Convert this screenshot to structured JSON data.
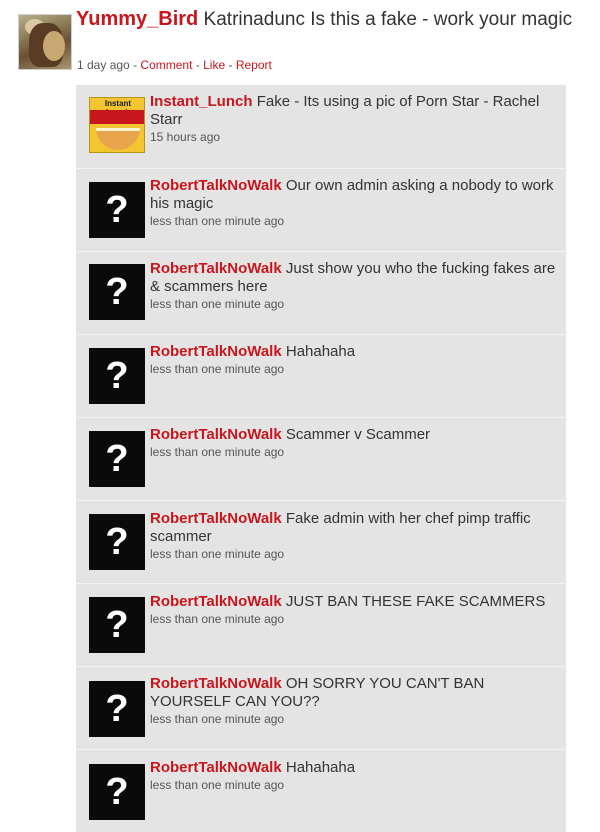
{
  "post": {
    "author": "Yummy_Bird",
    "text": "Katrinadunc Is this a fake - work your magic",
    "time": "1 day ago",
    "actions": {
      "separator": "-",
      "comment": "Comment",
      "like": "Like",
      "report": "Report"
    }
  },
  "replies": [
    {
      "author": "Instant_Lunch",
      "text": "Fake - Its using a pic of Porn Star - Rachel Starr",
      "time": "15 hours ago",
      "avatar_icon": "instant-lunch-noodle-icon",
      "avatar_text": "Instant Lunch"
    },
    {
      "author": "RobertTalkNoWalk",
      "text": "Our own admin asking a nobody to work his magic",
      "time": "less than one minute ago",
      "avatar_icon": "question-mark-icon"
    },
    {
      "author": "RobertTalkNoWalk",
      "text": "Just show you who the fucking fakes are & scammers here",
      "time": "less than one minute ago",
      "avatar_icon": "question-mark-icon"
    },
    {
      "author": "RobertTalkNoWalk",
      "text": "Hahahaha",
      "time": "less than one minute ago",
      "avatar_icon": "question-mark-icon"
    },
    {
      "author": "RobertTalkNoWalk",
      "text": "Scammer v Scammer",
      "time": "less than one minute ago",
      "avatar_icon": "question-mark-icon"
    },
    {
      "author": "RobertTalkNoWalk",
      "text": "Fake admin with her chef pimp traffic scammer",
      "time": "less than one minute ago",
      "avatar_icon": "question-mark-icon"
    },
    {
      "author": "RobertTalkNoWalk",
      "text": "JUST BAN THESE FAKE SCAMMERS",
      "time": "less than one minute ago",
      "avatar_icon": "question-mark-icon"
    },
    {
      "author": "RobertTalkNoWalk",
      "text": "OH SORRY YOU CAN'T BAN YOURSELF CAN YOU??",
      "time": "less than one minute ago",
      "avatar_icon": "question-mark-icon"
    },
    {
      "author": "RobertTalkNoWalk",
      "text": "Hahahaha",
      "time": "less than one minute ago",
      "avatar_icon": "question-mark-icon"
    }
  ],
  "question_mark": "?",
  "colors": {
    "author_link": "#c8161d",
    "reply_background": "#e4e4e4",
    "avatar_background": "#0a0a0a"
  }
}
